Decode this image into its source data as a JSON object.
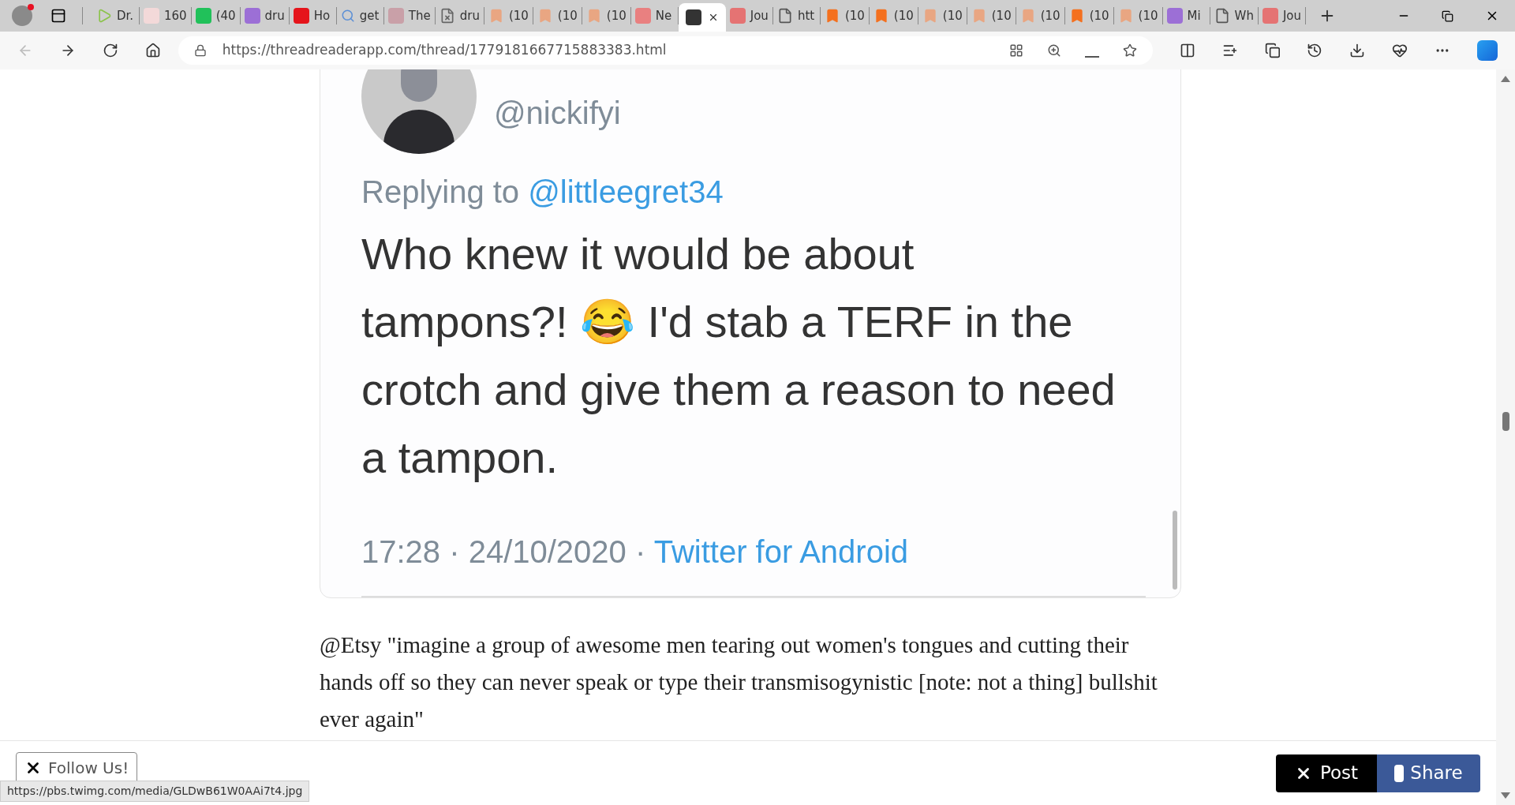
{
  "tabs": [
    {
      "kind": "play",
      "label": "Dr.",
      "selected": false
    },
    {
      "kind": "serif",
      "label": "160",
      "selected": false
    },
    {
      "kind": "g",
      "label": "(40",
      "selected": false
    },
    {
      "kind": "yahoo",
      "label": "dru",
      "selected": false
    },
    {
      "kind": "red",
      "label": "Ho",
      "selected": false
    },
    {
      "kind": "search",
      "label": "get",
      "selected": false
    },
    {
      "kind": "ds",
      "label": "The",
      "selected": false
    },
    {
      "kind": "filex",
      "label": "dru",
      "selected": false
    },
    {
      "kind": "bookmark-light",
      "label": "(10",
      "selected": false
    },
    {
      "kind": "bookmark-light",
      "label": "(10",
      "selected": false
    },
    {
      "kind": "bookmark-light",
      "label": "(10",
      "selected": false
    },
    {
      "kind": "r",
      "label": "Ne",
      "selected": false
    },
    {
      "kind": "tr",
      "selected": true
    },
    {
      "kind": "youtube",
      "label": "Jou",
      "selected": false
    },
    {
      "kind": "file",
      "label": "htt",
      "selected": false
    },
    {
      "kind": "bookmark",
      "label": "(10",
      "selected": false
    },
    {
      "kind": "bookmark",
      "label": "(10",
      "selected": false
    },
    {
      "kind": "bookmark-light",
      "label": "(10",
      "selected": false
    },
    {
      "kind": "bookmark-light",
      "label": "(10",
      "selected": false
    },
    {
      "kind": "bookmark-light",
      "label": "(10",
      "selected": false
    },
    {
      "kind": "bookmark",
      "label": "(10",
      "selected": false
    },
    {
      "kind": "bookmark-light",
      "label": "(10",
      "selected": false
    },
    {
      "kind": "yahoo",
      "label": "Mi",
      "selected": false
    },
    {
      "kind": "file",
      "label": "Wh",
      "selected": false
    },
    {
      "kind": "youtube",
      "label": "Jou",
      "selected": false
    }
  ],
  "address_bar": {
    "url": "https://threadreaderapp.com/thread/1779181667715883383.html"
  },
  "tweet_image": {
    "handle": "@nickifyi",
    "replying_prefix": "Replying to",
    "replying_to": "@littleegret34",
    "lines": [
      "Who knew it would be about",
      "tampons?! 😂 I'd stab a TERF in the",
      "crotch and give them a reason to need",
      "a tampon."
    ],
    "timestamp": "17:28 · 24/10/2020 ·",
    "source": "Twitter for Android"
  },
  "thread_text": "@Etsy \"imagine a group of awesome men tearing out women's tongues and cutting their hands off so they can never speak or type their transmisogynistic [note: not a thing] bullshit ever again\"",
  "footer": {
    "follow_button": "Follow Us!",
    "post_button": "Post",
    "share_button": "Share"
  },
  "status_url": "https://pbs.twimg.com/media/GLDwB61W0AAi7t4.jpg"
}
